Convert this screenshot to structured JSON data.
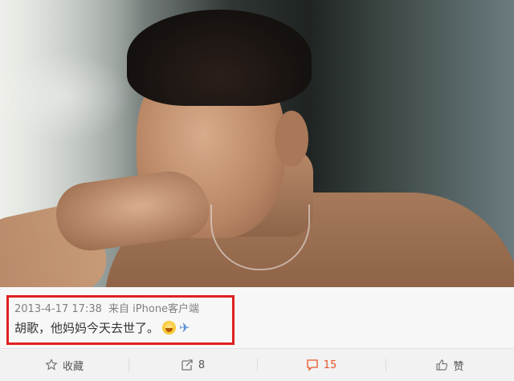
{
  "post": {
    "timestamp": "2013-4-17 17:38",
    "source_prefix": "来自",
    "source": "iPhone客户端",
    "text": "胡歌，他妈妈今天去世了。"
  },
  "actions": {
    "favorite_label": "收藏",
    "repost_count": "8",
    "comment_count": "15",
    "like_label": "赞"
  },
  "icons": {
    "emoji": "crying-face-icon",
    "plane": "airplane-icon",
    "favorite": "star-icon",
    "repost": "repost-icon",
    "comment": "comment-icon",
    "like": "thumbs-up-icon"
  },
  "colors": {
    "highlight": "#e02020",
    "comment_active": "#e8552a"
  }
}
